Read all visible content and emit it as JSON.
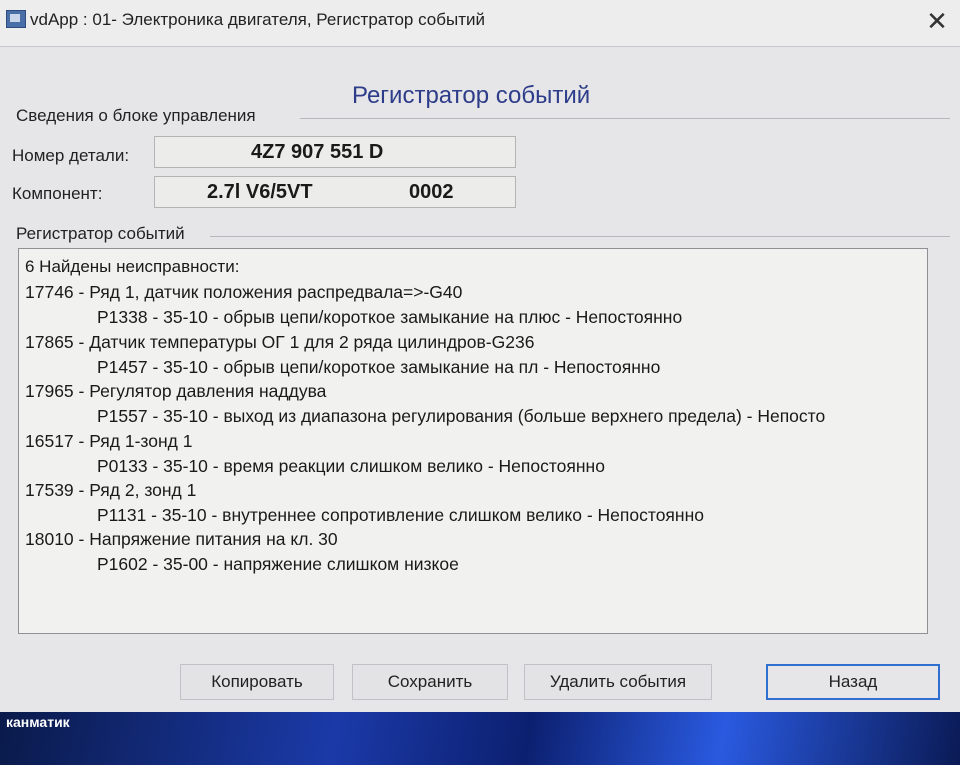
{
  "window": {
    "title": "vdApp : 01- Электроника двигателя,  Регистратор событий",
    "close_glyph": "✕",
    "heading": "Регистратор событий"
  },
  "control_unit": {
    "group_label": "Сведения о блоке управления",
    "part_number_label": "Номер детали:",
    "part_number_value": "4Z7 907 551 D",
    "component_label": "Компонент:",
    "component_engine": "2.7l V6/5VT",
    "component_code": "0002"
  },
  "events": {
    "group_label": "Регистратор событий",
    "summary": "6 Найдены неисправности:",
    "items": [
      {
        "title": "17746 - Ряд 1, датчик положения распредвала=>-G40",
        "detail": "P1338 - 35-10 - обрыв цепи/короткое замыкание на плюс - Непостоянно"
      },
      {
        "title": "17865 - Датчик температуры ОГ 1 для 2 ряда цилиндров-G236",
        "detail": "P1457 - 35-10 - обрыв цепи/короткое замыкание на пл - Непостоянно"
      },
      {
        "title": "17965 - Регулятор давления наддува",
        "detail": "P1557 - 35-10 - выход из диапазона регулирования (больше верхнего предела) - Непосто"
      },
      {
        "title": "16517 - Ряд 1-зонд 1",
        "detail": "P0133 - 35-10 - время реакции слишком велико - Непостоянно"
      },
      {
        "title": "17539 - Ряд 2, зонд 1",
        "detail": "P1131 - 35-10 - внутреннее сопротивление слишком велико - Непостоянно"
      },
      {
        "title": "18010 - Напряжение питания на кл. 30",
        "detail": "P1602 - 35-00 - напряжение слишком низкое"
      }
    ]
  },
  "buttons": {
    "copy": "Копировать",
    "save": "Сохранить",
    "delete": "Удалить события",
    "back": "Назад"
  },
  "taskbar": {
    "label": "канматик"
  }
}
